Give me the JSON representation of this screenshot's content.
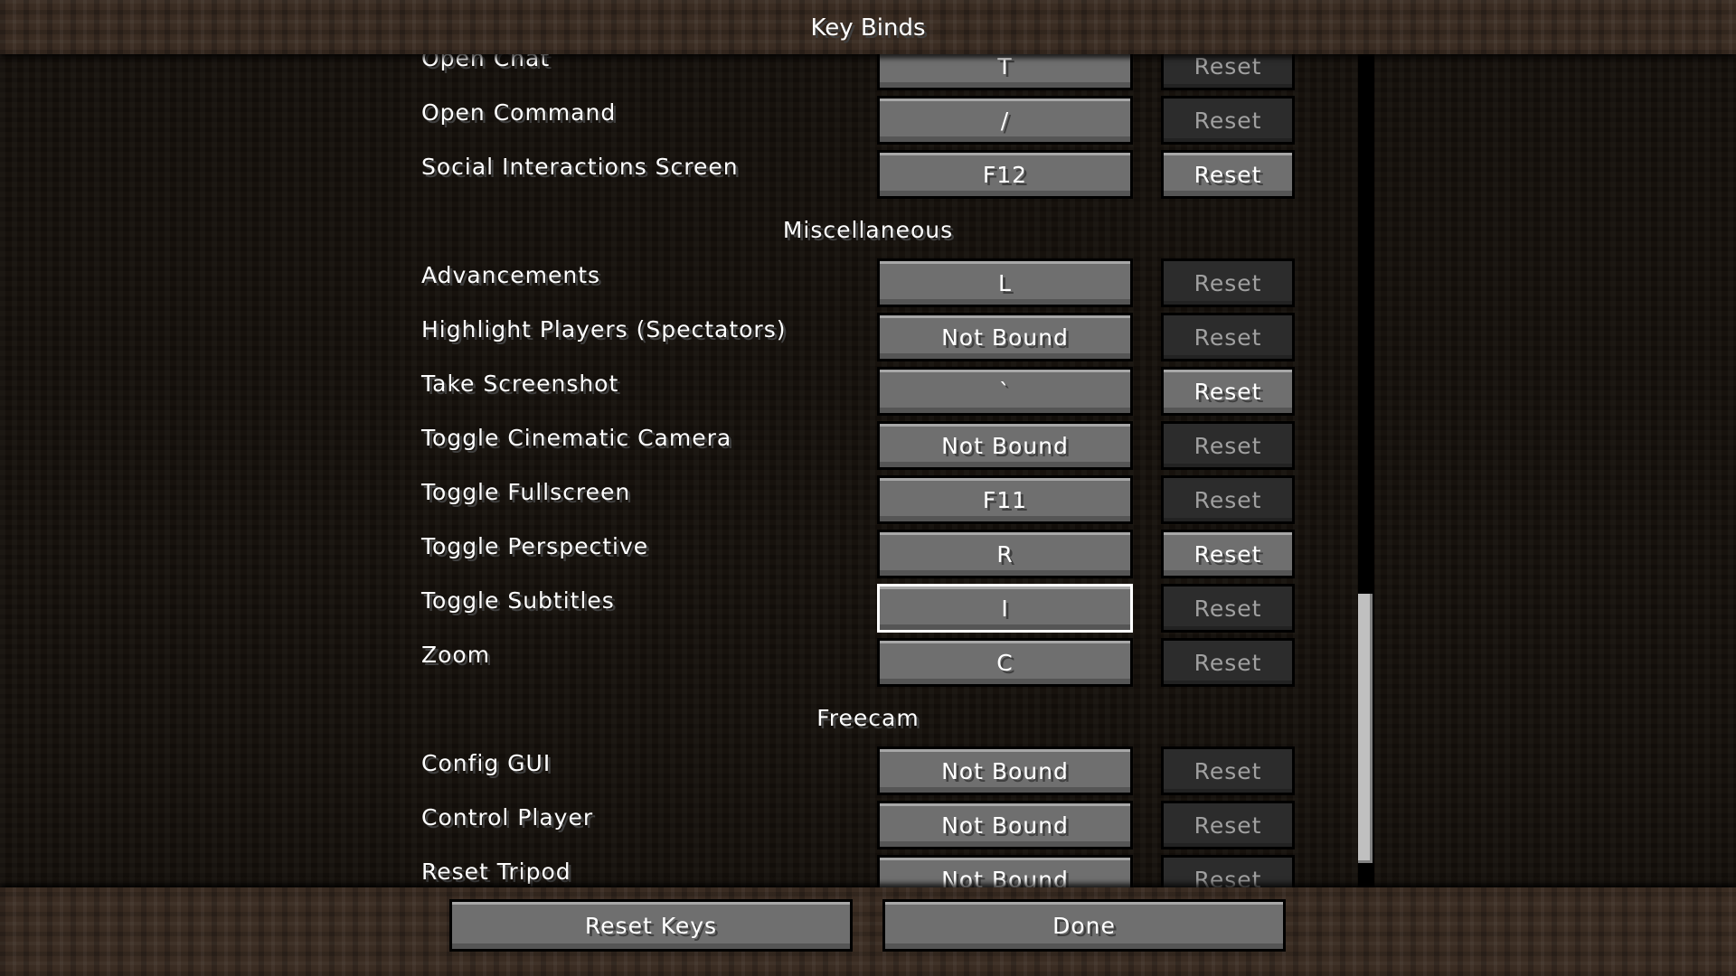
{
  "title": "Key Binds",
  "reset_label": "Reset",
  "rows": [
    {
      "type": "bind",
      "label": "Open Chat",
      "key": "T",
      "reset_enabled": false
    },
    {
      "type": "bind",
      "label": "Open Command",
      "key": "/",
      "reset_enabled": false
    },
    {
      "type": "bind",
      "label": "Social Interactions Screen",
      "key": "F12",
      "reset_enabled": true
    },
    {
      "type": "category",
      "label": "Miscellaneous"
    },
    {
      "type": "bind",
      "label": "Advancements",
      "key": "L",
      "reset_enabled": false
    },
    {
      "type": "bind",
      "label": "Highlight Players (Spectators)",
      "key": "Not Bound",
      "reset_enabled": false
    },
    {
      "type": "bind",
      "label": "Take Screenshot",
      "key": "`",
      "reset_enabled": true
    },
    {
      "type": "bind",
      "label": "Toggle Cinematic Camera",
      "key": "Not Bound",
      "reset_enabled": false
    },
    {
      "type": "bind",
      "label": "Toggle Fullscreen",
      "key": "F11",
      "reset_enabled": false
    },
    {
      "type": "bind",
      "label": "Toggle Perspective",
      "key": "R",
      "reset_enabled": true
    },
    {
      "type": "bind",
      "label": "Toggle Subtitles",
      "key": "I",
      "reset_enabled": false,
      "focused": true
    },
    {
      "type": "bind",
      "label": "Zoom",
      "key": "C",
      "reset_enabled": false
    },
    {
      "type": "category",
      "label": "Freecam"
    },
    {
      "type": "bind",
      "label": "Config GUI",
      "key": "Not Bound",
      "reset_enabled": false
    },
    {
      "type": "bind",
      "label": "Control Player",
      "key": "Not Bound",
      "reset_enabled": false
    },
    {
      "type": "bind",
      "label": "Reset Tripod",
      "key": "Not Bound",
      "reset_enabled": false
    }
  ],
  "scrollbar": {
    "position_fraction": 0.86
  },
  "footer": {
    "reset_keys_label": "Reset Keys",
    "done_label": "Done"
  }
}
